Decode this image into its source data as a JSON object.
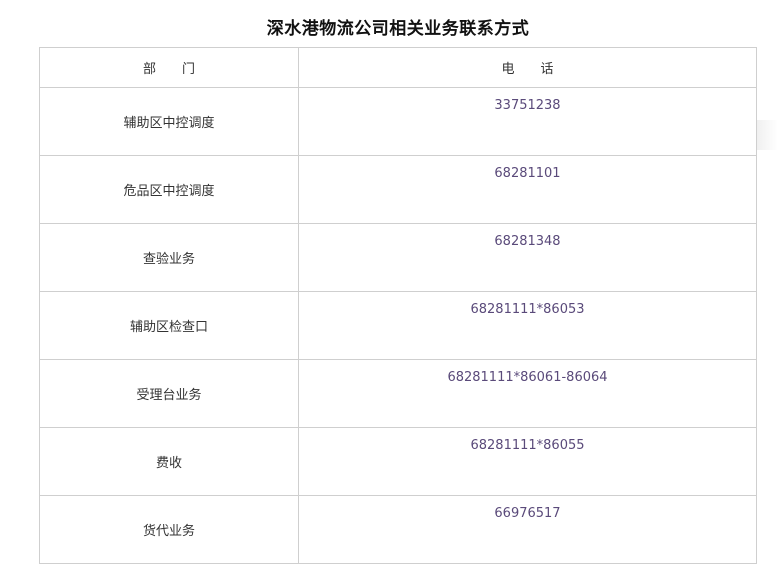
{
  "title": "深水港物流公司相关业务联系方式",
  "table": {
    "headers": {
      "department": "部　　门",
      "phone": "电　　话"
    },
    "rows": [
      {
        "department": "辅助区中控调度",
        "phone": "33751238"
      },
      {
        "department": "危品区中控调度",
        "phone": "68281101"
      },
      {
        "department": "查验业务",
        "phone": "68281348"
      },
      {
        "department": "辅助区检查口",
        "phone": "68281111*86053"
      },
      {
        "department": "受理台业务",
        "phone": "68281111*86061-86064"
      },
      {
        "department": "费收",
        "phone": "68281111*86055"
      },
      {
        "department": "货代业务",
        "phone": "66976517"
      }
    ]
  }
}
